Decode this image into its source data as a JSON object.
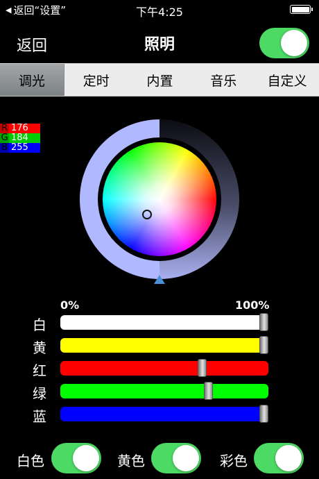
{
  "status_bar": {
    "back_label": "返回“设置”",
    "time": "下午4:25"
  },
  "nav": {
    "back_label": "返回",
    "title": "照明",
    "power_on": true
  },
  "tabs": [
    {
      "label": "调光",
      "active": true
    },
    {
      "label": "定时",
      "active": false
    },
    {
      "label": "内置",
      "active": false
    },
    {
      "label": "音乐",
      "active": false
    },
    {
      "label": "自定义",
      "active": false
    }
  ],
  "rgb": {
    "r_key": "R",
    "r": "176",
    "g_key": "G",
    "g": "184",
    "b_key": "B",
    "b": "255"
  },
  "scale": {
    "min_label": "0%",
    "max_label": "100%"
  },
  "sliders": [
    {
      "label": "白",
      "color": "#ffffff",
      "value": 1.0
    },
    {
      "label": "黄",
      "color": "#ffff00",
      "value": 1.0
    },
    {
      "label": "红",
      "color": "#ff0000",
      "value": 0.69
    },
    {
      "label": "绿",
      "color": "#00ff00",
      "value": 0.72
    },
    {
      "label": "蓝",
      "color": "#0000ff",
      "value": 1.0
    }
  ],
  "bottom_toggles": [
    {
      "label": "白色",
      "on": true
    },
    {
      "label": "黄色",
      "on": true
    },
    {
      "label": "彩色",
      "on": true
    }
  ],
  "colors": {
    "accent_green": "#4cd964",
    "ring_color": "#b0b8ff"
  }
}
